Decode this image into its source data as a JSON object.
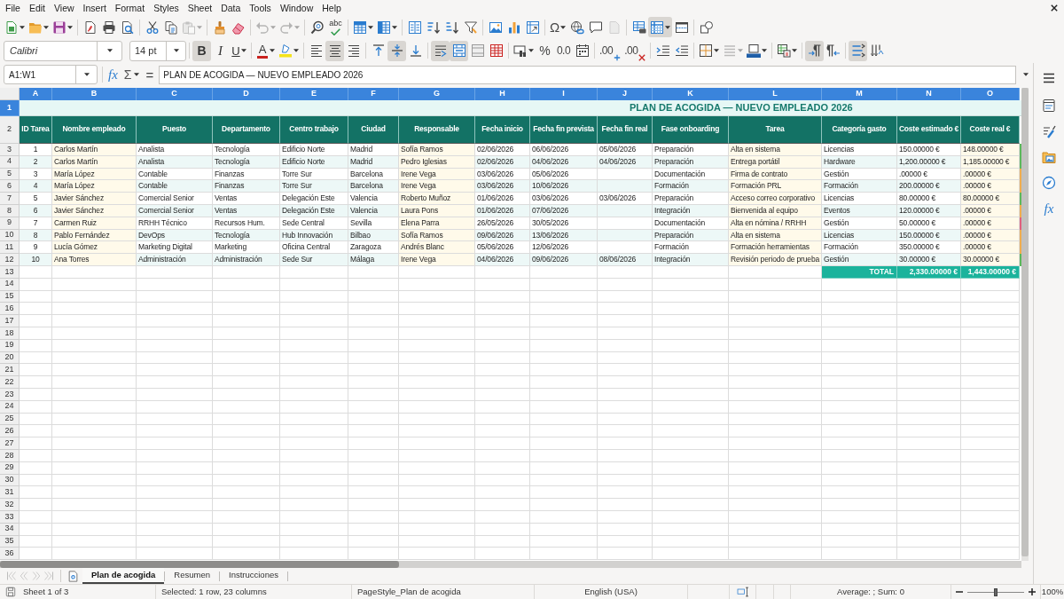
{
  "menu_bar": {
    "items": [
      "File",
      "Edit",
      "View",
      "Insert",
      "Format",
      "Styles",
      "Sheet",
      "Data",
      "Tools",
      "Window",
      "Help"
    ]
  },
  "standard_toolbar": {
    "groups": [
      [
        {
          "kind": "new",
          "pressed": false,
          "disabled": false,
          "dropdown": true
        },
        {
          "kind": "open",
          "pressed": false,
          "disabled": false,
          "dropdown": true
        },
        {
          "kind": "save",
          "pressed": false,
          "disabled": false,
          "dropdown": true
        }
      ],
      [
        {
          "kind": "pdf",
          "pressed": false,
          "disabled": false,
          "dropdown": false
        },
        {
          "kind": "print",
          "pressed": false,
          "disabled": false,
          "dropdown": false
        },
        {
          "kind": "preview",
          "pressed": false,
          "disabled": false,
          "dropdown": false
        }
      ],
      [
        {
          "kind": "cut",
          "pressed": false,
          "disabled": false,
          "dropdown": false
        },
        {
          "kind": "copy",
          "pressed": false,
          "disabled": false,
          "dropdown": false
        },
        {
          "kind": "paste",
          "pressed": false,
          "disabled": true,
          "dropdown": true
        }
      ],
      [
        {
          "kind": "clone",
          "pressed": false,
          "disabled": false,
          "dropdown": false
        },
        {
          "kind": "clear",
          "pressed": false,
          "disabled": false,
          "dropdown": false
        }
      ],
      [
        {
          "kind": "undo",
          "pressed": false,
          "disabled": true,
          "dropdown": true
        },
        {
          "kind": "redo",
          "pressed": false,
          "disabled": true,
          "dropdown": true
        }
      ],
      [
        {
          "kind": "find",
          "pressed": false,
          "disabled": false,
          "dropdown": false
        },
        {
          "kind": "spelling",
          "label": "abc",
          "pressed": false,
          "disabled": false,
          "dropdown": false
        }
      ],
      [
        {
          "kind": "rows",
          "pressed": false,
          "disabled": false,
          "dropdown": true
        },
        {
          "kind": "columns",
          "pressed": false,
          "disabled": false,
          "dropdown": true
        }
      ],
      [
        {
          "kind": "sortdialog",
          "pressed": false,
          "disabled": false,
          "dropdown": false
        },
        {
          "kind": "sortasc",
          "pressed": false,
          "disabled": false,
          "dropdown": false
        },
        {
          "kind": "sortdesc",
          "pressed": false,
          "disabled": false,
          "dropdown": false
        },
        {
          "kind": "filter",
          "pressed": false,
          "disabled": false,
          "dropdown": false
        }
      ],
      [
        {
          "kind": "image",
          "pressed": false,
          "disabled": false,
          "dropdown": false
        },
        {
          "kind": "chart",
          "pressed": false,
          "disabled": false,
          "dropdown": false
        },
        {
          "kind": "pivot",
          "pressed": false,
          "disabled": false,
          "dropdown": false
        }
      ],
      [
        {
          "kind": "special",
          "label": "Ω",
          "pressed": false,
          "disabled": false,
          "dropdown": true
        },
        {
          "kind": "hyperlink",
          "pressed": false,
          "disabled": false,
          "dropdown": false
        },
        {
          "kind": "comment",
          "pressed": false,
          "disabled": false,
          "dropdown": false
        },
        {
          "kind": "headerfooter",
          "pressed": false,
          "disabled": true,
          "dropdown": false
        }
      ],
      [
        {
          "kind": "printarea",
          "pressed": false,
          "disabled": false,
          "dropdown": false
        },
        {
          "kind": "freeze",
          "pressed": true,
          "disabled": false,
          "dropdown": true
        },
        {
          "kind": "split",
          "pressed": false,
          "disabled": false,
          "dropdown": false
        }
      ],
      [
        {
          "kind": "shapes",
          "pressed": false,
          "disabled": false,
          "dropdown": false
        }
      ]
    ]
  },
  "formatting_toolbar": {
    "font_name": "Calibri",
    "font_size": "14 pt",
    "groups": [
      [
        {
          "kind": "bold",
          "label": "B",
          "pressed": true,
          "disabled": false,
          "dropdown": false
        },
        {
          "kind": "italic",
          "label": "I",
          "pressed": false,
          "disabled": false,
          "dropdown": false
        },
        {
          "kind": "underline",
          "label": "U",
          "pressed": false,
          "disabled": false,
          "dropdown": true
        }
      ],
      [
        {
          "kind": "fontcolor",
          "label": "A",
          "pressed": false,
          "disabled": false,
          "dropdown": true
        },
        {
          "kind": "highlight",
          "pressed": false,
          "disabled": false,
          "dropdown": true
        }
      ],
      [
        {
          "kind": "left",
          "pressed": false,
          "disabled": false,
          "dropdown": false
        },
        {
          "kind": "center",
          "pressed": true,
          "disabled": false,
          "dropdown": false
        },
        {
          "kind": "right",
          "pressed": false,
          "disabled": false,
          "dropdown": false
        }
      ],
      [
        {
          "kind": "top",
          "pressed": false,
          "disabled": false,
          "dropdown": false
        },
        {
          "kind": "middle",
          "pressed": true,
          "disabled": false,
          "dropdown": false
        },
        {
          "kind": "bottom",
          "pressed": false,
          "disabled": false,
          "dropdown": false
        }
      ],
      [
        {
          "kind": "wrap",
          "pressed": true,
          "disabled": false,
          "dropdown": false
        },
        {
          "kind": "mergecenter",
          "pressed": true,
          "disabled": false,
          "dropdown": false
        },
        {
          "kind": "merge",
          "pressed": false,
          "disabled": false,
          "dropdown": false
        },
        {
          "kind": "unmerge",
          "pressed": false,
          "disabled": false,
          "dropdown": false
        }
      ],
      [
        {
          "kind": "currency",
          "pressed": false,
          "disabled": false,
          "dropdown": true
        },
        {
          "kind": "percent",
          "label": "%",
          "pressed": false,
          "disabled": false,
          "dropdown": false
        },
        {
          "kind": "number",
          "label": "0.0",
          "pressed": false,
          "disabled": false,
          "dropdown": false
        },
        {
          "kind": "date",
          "pressed": false,
          "disabled": false,
          "dropdown": false
        }
      ],
      [
        {
          "kind": "adddecimal",
          "label": ".00",
          "pressed": false,
          "disabled": false,
          "dropdown": false
        },
        {
          "kind": "deldecimal",
          "label": ".00",
          "pressed": false,
          "disabled": false,
          "dropdown": false
        }
      ],
      [
        {
          "kind": "indent",
          "pressed": false,
          "disabled": false,
          "dropdown": false
        },
        {
          "kind": "outdent",
          "pressed": false,
          "disabled": false,
          "dropdown": false
        }
      ],
      [
        {
          "kind": "borders",
          "pressed": false,
          "disabled": false,
          "dropdown": true
        },
        {
          "kind": "borderstyle",
          "pressed": false,
          "disabled": true,
          "dropdown": true
        },
        {
          "kind": "bordercolor",
          "pressed": false,
          "disabled": false,
          "dropdown": true
        }
      ],
      [
        {
          "kind": "conditional",
          "pressed": false,
          "disabled": false,
          "dropdown": true
        }
      ],
      [
        {
          "kind": "ltr",
          "pressed": true,
          "disabled": false,
          "dropdown": false
        },
        {
          "kind": "rtl",
          "pressed": false,
          "disabled": false,
          "dropdown": false
        }
      ],
      [
        {
          "kind": "textdir",
          "pressed": true,
          "disabled": false,
          "dropdown": false
        },
        {
          "kind": "vertical",
          "pressed": false,
          "disabled": false,
          "dropdown": false
        }
      ]
    ]
  },
  "formula_bar": {
    "name_box": "A1:W1",
    "function_wizard": "fx",
    "sum": "Σ",
    "equals": "=",
    "content": "PLAN DE ACOGIDA — NUEVO EMPLEADO 2026"
  },
  "sheet": {
    "columns": [
      {
        "label": "A",
        "selected": true
      },
      {
        "label": "B",
        "selected": true
      },
      {
        "label": "C",
        "selected": true
      },
      {
        "label": "D",
        "selected": true
      },
      {
        "label": "E",
        "selected": true
      },
      {
        "label": "F",
        "selected": true
      },
      {
        "label": "G",
        "selected": true
      },
      {
        "label": "H",
        "selected": true
      },
      {
        "label": "I",
        "selected": true
      },
      {
        "label": "J",
        "selected": true
      },
      {
        "label": "K",
        "selected": true
      },
      {
        "label": "L",
        "selected": true
      },
      {
        "label": "M",
        "selected": true
      },
      {
        "label": "N",
        "selected": true
      },
      {
        "label": "O",
        "selected": true
      }
    ],
    "row_headers": [
      {
        "label": "1",
        "selected": true
      },
      {
        "label": "2",
        "selected": false
      },
      {
        "label": "3",
        "selected": false
      },
      {
        "label": "4",
        "selected": false
      },
      {
        "label": "5",
        "selected": false
      },
      {
        "label": "6",
        "selected": false
      },
      {
        "label": "7",
        "selected": false
      },
      {
        "label": "8",
        "selected": false
      },
      {
        "label": "9",
        "selected": false
      },
      {
        "label": "10",
        "selected": false
      },
      {
        "label": "11",
        "selected": false
      },
      {
        "label": "12",
        "selected": false
      },
      {
        "label": "13",
        "selected": false
      },
      {
        "label": "14",
        "selected": false
      },
      {
        "label": "15",
        "selected": false
      },
      {
        "label": "16",
        "selected": false
      },
      {
        "label": "17",
        "selected": false
      },
      {
        "label": "18",
        "selected": false
      },
      {
        "label": "19",
        "selected": false
      },
      {
        "label": "20",
        "selected": false
      },
      {
        "label": "21",
        "selected": false
      },
      {
        "label": "22",
        "selected": false
      },
      {
        "label": "23",
        "selected": false
      },
      {
        "label": "24",
        "selected": false
      },
      {
        "label": "25",
        "selected": false
      },
      {
        "label": "26",
        "selected": false
      },
      {
        "label": "27",
        "selected": false
      },
      {
        "label": "28",
        "selected": false
      },
      {
        "label": "29",
        "selected": false
      },
      {
        "label": "30",
        "selected": false
      },
      {
        "label": "31",
        "selected": false
      },
      {
        "label": "32",
        "selected": false
      },
      {
        "label": "33",
        "selected": false
      },
      {
        "label": "34",
        "selected": false
      },
      {
        "label": "35",
        "selected": false
      },
      {
        "label": "36",
        "selected": false
      }
    ],
    "title": "PLAN DE ACOGIDA — NUEVO EMPLEADO 2026",
    "header": [
      "ID Tarea",
      "Nombre empleado",
      "Puesto",
      "Departamento",
      "Centro trabajo",
      "Ciudad",
      "Responsable",
      "Fecha inicio",
      "Fecha fin prevista",
      "Fecha fin real",
      "Fase onboarding",
      "Tarea",
      "Categoría gasto",
      "Coste estimado €",
      "Coste real €"
    ],
    "rows": [
      {
        "id_tarea": "1",
        "nombre_empleado": "Carlos Martín",
        "puesto": "Analista",
        "departamento": "Tecnología",
        "centro_trabajo": "Edificio Norte",
        "ciudad": "Madrid",
        "responsable": "Sofía Ramos",
        "fecha_inicio": "02/06/2026",
        "fecha_fin_prevista": "06/06/2026",
        "fecha_fin_real": "05/06/2026",
        "fase_onboarding": "Preparación",
        "tarea": "Alta en sistema",
        "categoria_gasto": "Licencias",
        "coste_estimado": "150.00000 €",
        "coste_real": "148.00000 €",
        "color": "#5cb85c"
      },
      {
        "id_tarea": "2",
        "nombre_empleado": "Carlos Martín",
        "puesto": "Analista",
        "departamento": "Tecnología",
        "centro_trabajo": "Edificio Norte",
        "ciudad": "Madrid",
        "responsable": "Pedro Iglesias",
        "fecha_inicio": "02/06/2026",
        "fecha_fin_prevista": "04/06/2026",
        "fecha_fin_real": "04/06/2026",
        "fase_onboarding": "Preparación",
        "tarea": "Entrega portátil",
        "categoria_gasto": "Hardware",
        "coste_estimado": "1,200.00000 €",
        "coste_real": "1,185.00000 €",
        "color": "#5cb85c"
      },
      {
        "id_tarea": "3",
        "nombre_empleado": "María López",
        "puesto": "Contable",
        "departamento": "Finanzas",
        "centro_trabajo": "Torre Sur",
        "ciudad": "Barcelona",
        "responsable": "Irene Vega",
        "fecha_inicio": "03/06/2026",
        "fecha_fin_prevista": "05/06/2026",
        "fase_onboarding": "Documentación",
        "tarea": "Firma de contrato",
        "categoria_gasto": "Gestión",
        "coste_estimado": ".00000 €",
        "coste_real": ".00000 €",
        "color": "#f0ad4e"
      },
      {
        "id_tarea": "4",
        "nombre_empleado": "María López",
        "puesto": "Contable",
        "departamento": "Finanzas",
        "centro_trabajo": "Torre Sur",
        "ciudad": "Barcelona",
        "responsable": "Irene Vega",
        "fecha_inicio": "03/06/2026",
        "fecha_fin_prevista": "10/06/2026",
        "fase_onboarding": "Formación",
        "tarea": "Formación PRL",
        "categoria_gasto": "Formación",
        "coste_estimado": "200.00000 €",
        "coste_real": ".00000 €",
        "color": "#f0ad4e"
      },
      {
        "id_tarea": "5",
        "nombre_empleado": "Javier Sánchez",
        "puesto": "Comercial Senior",
        "departamento": "Ventas",
        "centro_trabajo": "Delegación Este",
        "ciudad": "Valencia",
        "responsable": "Roberto Muñoz",
        "fecha_inicio": "01/06/2026",
        "fecha_fin_prevista": "03/06/2026",
        "fecha_fin_real": "03/06/2026",
        "fase_onboarding": "Preparación",
        "tarea": "Acceso correo corporativo",
        "categoria_gasto": "Licencias",
        "coste_estimado": "80.00000 €",
        "coste_real": "80.00000 €",
        "color": "#5cb85c"
      },
      {
        "id_tarea": "6",
        "nombre_empleado": "Javier Sánchez",
        "puesto": "Comercial Senior",
        "departamento": "Ventas",
        "centro_trabajo": "Delegación Este",
        "ciudad": "Valencia",
        "responsable": "Laura Pons",
        "fecha_inicio": "01/06/2026",
        "fecha_fin_prevista": "07/06/2026",
        "fase_onboarding": "Integración",
        "tarea": "Bienvenida al equipo",
        "categoria_gasto": "Eventos",
        "coste_estimado": "120.00000 €",
        "coste_real": ".00000 €",
        "color": "#f0ad4e"
      },
      {
        "id_tarea": "7",
        "nombre_empleado": "Carmen Ruiz",
        "puesto": "RRHH Técnico",
        "departamento": "Recursos Hum.",
        "centro_trabajo": "Sede Central",
        "ciudad": "Sevilla",
        "responsable": "Elena Parra",
        "fecha_inicio": "26/05/2026",
        "fecha_fin_prevista": "30/05/2026",
        "fase_onboarding": "Documentación",
        "tarea": "Alta en nómina / RRHH",
        "categoria_gasto": "Gestión",
        "coste_estimado": "50.00000 €",
        "coste_real": ".00000 €",
        "color": "#e0607e"
      },
      {
        "id_tarea": "8",
        "nombre_empleado": "Pablo Fernández",
        "puesto": "DevOps",
        "departamento": "Tecnología",
        "centro_trabajo": "Hub Innovación",
        "ciudad": "Bilbao",
        "responsable": "Sofía Ramos",
        "fecha_inicio": "09/06/2026",
        "fecha_fin_prevista": "13/06/2026",
        "fase_onboarding": "Preparación",
        "tarea": "Alta en sistema",
        "categoria_gasto": "Licencias",
        "coste_estimado": "150.00000 €",
        "coste_real": ".00000 €",
        "color": "#f0ad4e"
      },
      {
        "id_tarea": "9",
        "nombre_empleado": "Lucía Gómez",
        "puesto": "Marketing Digital",
        "departamento": "Marketing",
        "centro_trabajo": "Oficina Central",
        "ciudad": "Zaragoza",
        "responsable": "Andrés Blanc",
        "fecha_inicio": "05/06/2026",
        "fecha_fin_prevista": "12/06/2026",
        "fase_onboarding": "Formación",
        "tarea": "Formación herramientas",
        "categoria_gasto": "Formación",
        "coste_estimado": "350.00000 €",
        "coste_real": ".00000 €",
        "color": "#f0ad4e"
      },
      {
        "id_tarea": "10",
        "nombre_empleado": "Ana Torres",
        "puesto": "Administración",
        "departamento": "Administración",
        "centro_trabajo": "Sede Sur",
        "ciudad": "Málaga",
        "responsable": "Irene Vega",
        "fecha_inicio": "04/06/2026",
        "fecha_fin_prevista": "09/06/2026",
        "fecha_fin_real": "08/06/2026",
        "fase_onboarding": "Integración",
        "tarea": "Revisión periodo de prueba",
        "categoria_gasto": "Gestión",
        "coste_estimado": "30.00000 €",
        "coste_real": "30.00000 €",
        "color": "#5cb85c"
      }
    ],
    "total": {
      "label": "TOTAL",
      "coste_estimado": "2,330.00000 €",
      "coste_real": "1,443.00000 €"
    }
  },
  "sidebar": {
    "buttons": [
      {
        "kind": "menu"
      },
      {
        "kind": "properties"
      },
      {
        "kind": "styles"
      },
      {
        "kind": "gallery"
      },
      {
        "kind": "navigator"
      },
      {
        "kind": "functions",
        "label": "fx"
      }
    ]
  },
  "sheet_tabs": {
    "navigation": [
      {
        "kind": "first",
        "disabled": true
      },
      {
        "kind": "previous",
        "disabled": true
      },
      {
        "kind": "next",
        "disabled": true
      },
      {
        "kind": "last",
        "disabled": true
      }
    ],
    "tabs": [
      {
        "label": "Plan de acogida",
        "selected": true
      },
      {
        "label": "Resumen",
        "selected": false
      },
      {
        "label": "Instrucciones",
        "selected": false
      }
    ]
  },
  "status_bar": {
    "sheet": "Sheet 1 of 3",
    "selection": "Selected: 1 row, 23 columns",
    "page_style": "PageStyle_Plan de acogida",
    "language": "English (USA)",
    "summary": "Average: ; Sum: 0",
    "zoom_slider": {
      "level": 0.5
    },
    "zoom": "100%"
  }
}
